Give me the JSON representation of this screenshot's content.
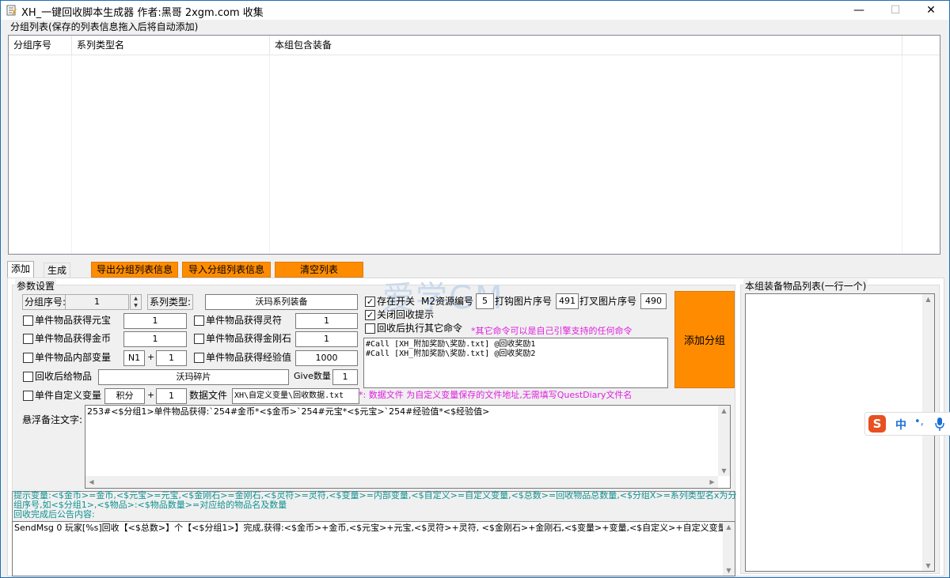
{
  "window": {
    "title": "XH_一键回收脚本生成器 作者:黑哥 2xgm.com 收集",
    "minimize": "—",
    "maximize": "☐",
    "close": "✕"
  },
  "group_list": {
    "title": "分组列表(保存的列表信息拖入后将自动添加)",
    "columns": [
      "分组序号",
      "系列类型名",
      "本组包含装备"
    ]
  },
  "tabs": [
    "添加",
    "生成"
  ],
  "toolbar": {
    "export": "导出分组列表信息",
    "import": "导入分组列表信息",
    "clear": "清空列表"
  },
  "params": {
    "title": "参数设置",
    "group_no_label": "分组序号:",
    "group_no_value": "1",
    "series_type_label": "系列类型:",
    "series_type_value": "沃玛系列装备",
    "yuanbao_label": "单件物品获得元宝",
    "yuanbao_value": "1",
    "lingfu_label": "单件物品获得灵符",
    "lingfu_value": "1",
    "gold_label": "单件物品获得金币",
    "gold_value": "1",
    "diamond_label": "单件物品获得金刚石",
    "diamond_value": "1",
    "var_label": "单件物品内部变量",
    "var_name": "N1",
    "plus": "+",
    "var_value": "1",
    "exp_label": "单件物品获得经验值",
    "exp_value": "1000",
    "give_label": "回收后给物品",
    "give_item": "沃玛碎片",
    "give_count_label": "Give数量",
    "give_count": "1",
    "custom_label": "单件自定义变量",
    "custom_name": "积分",
    "custom_value": "1",
    "datafile_label": "数据文件",
    "datafile_value": "XH\\自定义变量\\回收数据.txt",
    "datafile_hint": "*: 数据文件 为自定义变量保存的文件地址,无需填写QuestDiary文件名",
    "remark_label": "悬浮备注文字:",
    "remark_text": "253#<$分组1>单件物品获得:`254#金币*<$金币>`254#元宝*<$元宝>`254#经验值*<$经验值>"
  },
  "right_options": {
    "exist_switch_label": "存在开关",
    "m2_label": "M2资源编号",
    "m2_value": "5",
    "check_img_label": "打钩图片序号",
    "check_img_value": "491",
    "cross_img_label": "打叉图片序号",
    "cross_img_value": "490",
    "close_tip_label": "关闭回收提示",
    "run_other_label": "回收后执行其它命令",
    "other_hint": "*其它命令可以是自己引擎支持的任何命令",
    "commands": "#Call [XH_附加奖励\\奖励.txt] @回收奖励1\n#Call [XH_附加奖励\\奖励.txt] @回收奖励2"
  },
  "add_group_button": "添加分组",
  "equip_list": {
    "title": "本组装备物品列表(一行一个)"
  },
  "vars_hint": {
    "line1": "提示变量:<$金币>=金币,<$元宝>=元宝,<$金刚石>=金刚石,<$灵符>=灵符,<$变量>=内部变量,<$自定义>=自定义变量,<$总数>=回收物品总数量,<$分组X>=系列类型名x为分",
    "line2": "组序号,如<$分组1>,<$物品>:<$物品数量>=对应给的物品名及数量",
    "line3": "回收完成后公告内容:",
    "announce": "SendMsg 0 玩家[%s]回收【<$总数>】个【<$分组1>】完成,获得:<$金币>+金币,<$元宝>+元宝,<$灵符>+灵符, <$金刚石>+金刚石,<$变量>+变量,<$自定义>+自定义变量"
  },
  "watermark": "爱学GM",
  "ime": {
    "logo": "S",
    "lang": "中",
    "punct": "•,"
  },
  "colors": {
    "orange": "#ff8c00",
    "pink_hint": "#e020e0",
    "teal_hint": "#109090"
  }
}
